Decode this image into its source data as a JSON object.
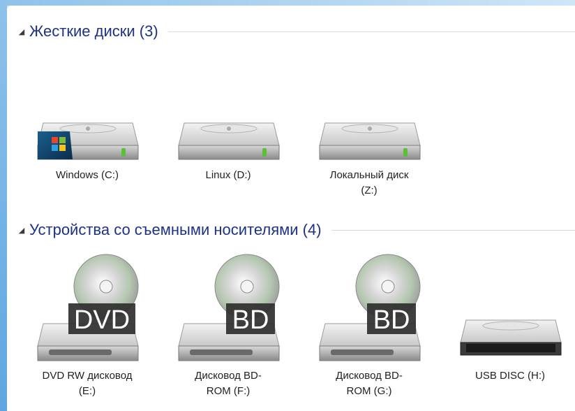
{
  "hard_disks": {
    "title": "Жесткие диски (3)",
    "items": [
      {
        "label": "Windows (C:)",
        "icon": "windows-drive-icon"
      },
      {
        "label": "Linux (D:)",
        "icon": "hard-drive-icon"
      },
      {
        "label": "Локальный диск (Z:)",
        "icon": "hard-drive-icon"
      }
    ]
  },
  "removable": {
    "title": "Устройства со съемными носителями (4)",
    "items": [
      {
        "label": "DVD RW дисковод (E:)",
        "badge": "DVD",
        "icon": "dvd-drive-icon"
      },
      {
        "label": "Дисковод BD-ROM (F:)",
        "badge": "BD",
        "icon": "bd-drive-icon"
      },
      {
        "label": "Дисковод BD-ROM (G:)",
        "badge": "BD",
        "icon": "bd-drive-icon"
      },
      {
        "label": "USB DISC (H:)",
        "icon": "usb-drive-icon"
      }
    ]
  },
  "colors": {
    "group_title": "#1e3287",
    "window_frame": "#8fc2ea"
  }
}
